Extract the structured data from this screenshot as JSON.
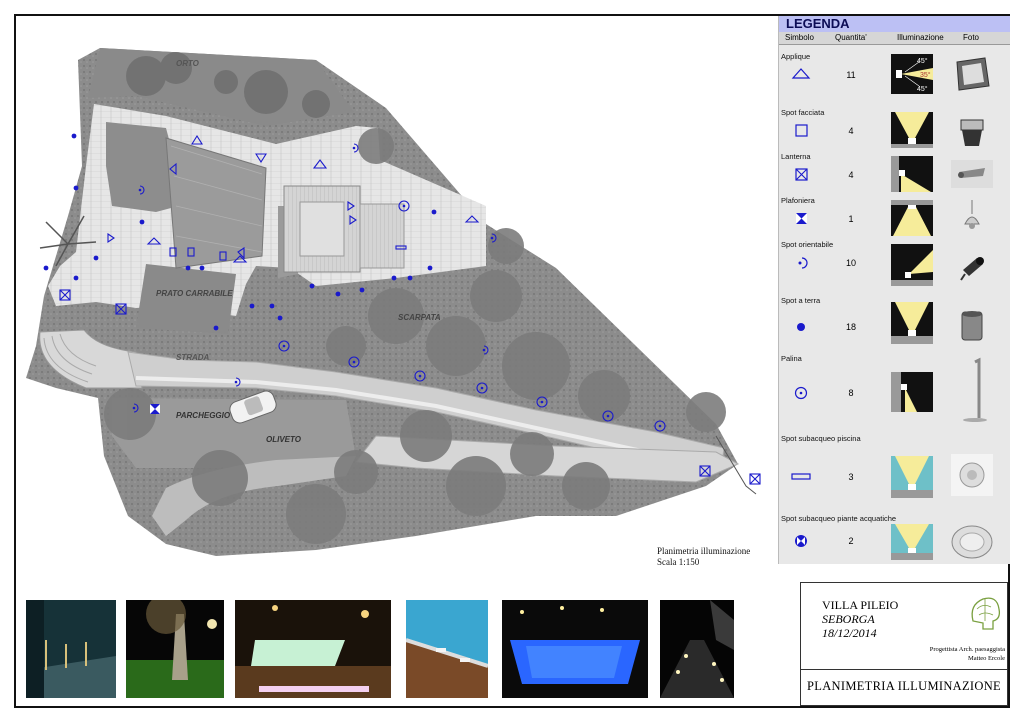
{
  "legend": {
    "title": "LEGENDA",
    "headers": {
      "symbol": "Simbolo",
      "quantity": "Quantita'",
      "illumination": "Illuminazione",
      "photo": "Foto"
    },
    "items": [
      {
        "name": "Applique",
        "qty": "11",
        "symbol": "triangle-outline-icon",
        "angles": [
          "45°",
          "35°",
          "45°"
        ]
      },
      {
        "name": "Spot facciata",
        "qty": "4",
        "symbol": "square-outline-icon"
      },
      {
        "name": "Lanterna",
        "qty": "4",
        "symbol": "crossed-square-icon"
      },
      {
        "name": "Plafoniera",
        "qty": "1",
        "symbol": "bowtie-square-icon"
      },
      {
        "name": "Spot orientabile",
        "qty": "10",
        "symbol": "dot-arc-icon"
      },
      {
        "name": "Spot a terra",
        "qty": "18",
        "symbol": "filled-dot-icon"
      },
      {
        "name": "Palina",
        "qty": "8",
        "symbol": "circled-dot-icon"
      },
      {
        "name": "Spot subacqueo piscina",
        "qty": "3",
        "symbol": "rectangle-outline-icon"
      },
      {
        "name": "Spot subacqueo piante acquatiche",
        "qty": "2",
        "symbol": "filled-circle-bowtie-icon"
      }
    ]
  },
  "plan_labels": {
    "orto": "ORTO",
    "prato": "PRATO CARRABILE",
    "scarpata": "SCARPATA",
    "strada": "STRADA",
    "parcheggio": "PARCHEGGIO",
    "oliveto": "OLIVETO"
  },
  "caption": {
    "title": "Planimetria illuminazione",
    "scale": "Scala 1:150"
  },
  "titleblock": {
    "villa": "VILLA PILEIO",
    "town": "SEBORGA",
    "date": "18/12/2014",
    "designer_role": "Progettista  Arch. paesaggista",
    "designer_name": "Matteo Ercole",
    "drawing_title": "PLANIMETRIA ILLUMINAZIONE"
  },
  "colors": {
    "legend_header": "#bcc0f4",
    "symbol_blue": "#1a1acc",
    "light_yellow": "#f6ec9a",
    "pool_blue": "#2a66ff"
  }
}
